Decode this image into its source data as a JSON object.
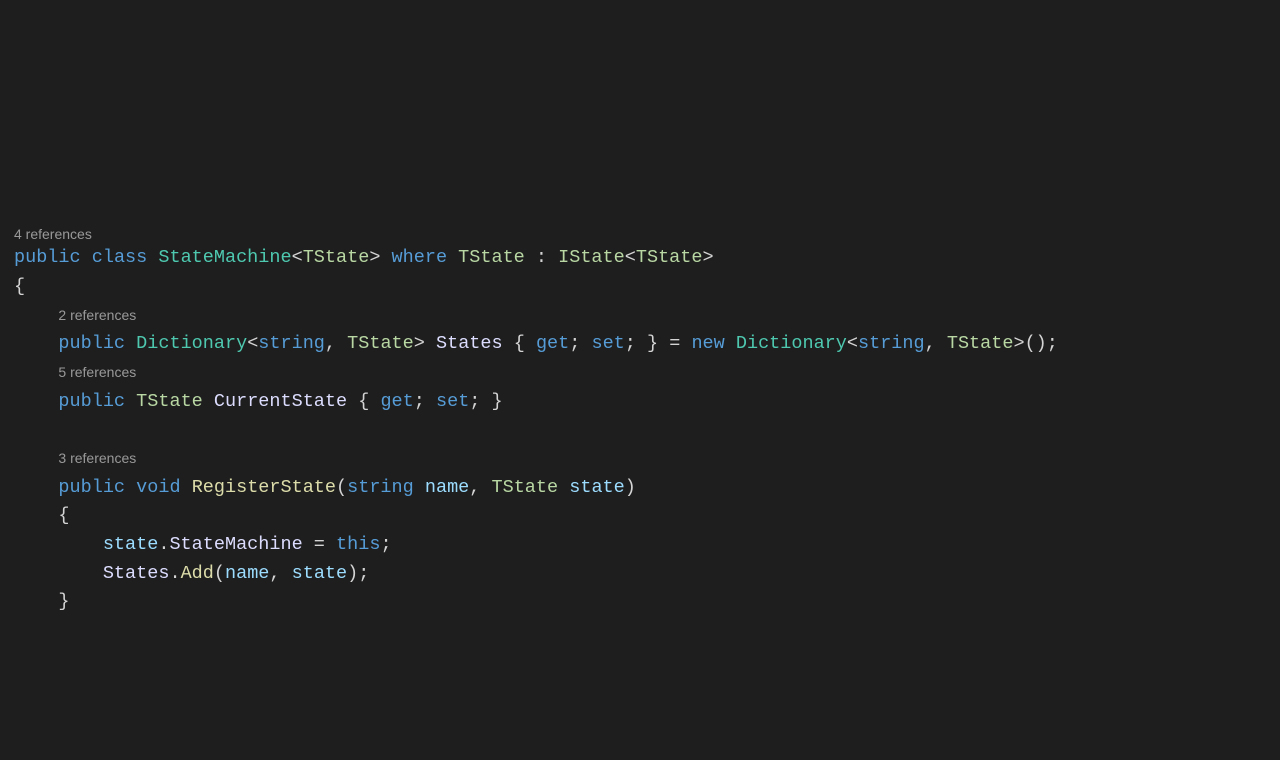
{
  "codelens": {
    "class": "4 references",
    "states": "2 references",
    "currentState": "5 references",
    "registerState": "3 references"
  },
  "code": {
    "public": "public",
    "class": "class",
    "void": "void",
    "where": "where",
    "new": "new",
    "this": "this",
    "get": "get",
    "set": "set",
    "string": "string",
    "StateMachine": "StateMachine",
    "TState": "TState",
    "IState": "IState",
    "Dictionary": "Dictionary",
    "States": "States",
    "CurrentState": "CurrentState",
    "RegisterState": "RegisterState",
    "name": "name",
    "state": "state",
    "Add": "Add",
    "lt": "<",
    "gt": ">",
    "colon": ":",
    "comma": ",",
    "space": " ",
    "lbrace": "{",
    "rbrace": "}",
    "lparen": "(",
    "rparen": ")",
    "semi": ";",
    "dot": ".",
    "eq": "=",
    "parens": "()"
  }
}
